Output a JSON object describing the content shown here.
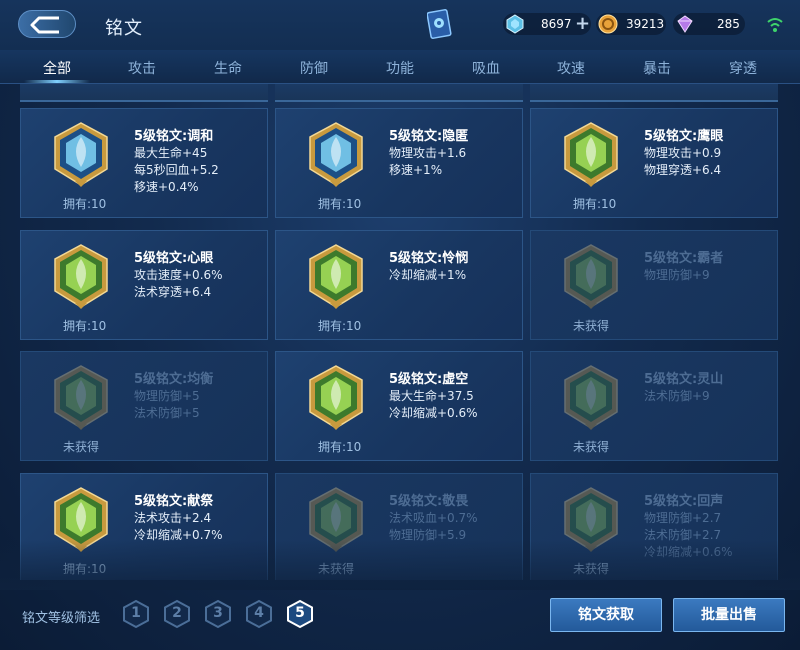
{
  "header": {
    "title": "铭文",
    "currencies": [
      {
        "icon": "diamond-icon",
        "value": "8697"
      },
      {
        "icon": "gold-coin-icon",
        "value": "39213"
      },
      {
        "icon": "purple-crystal-icon",
        "value": "285"
      }
    ]
  },
  "tabs": [
    {
      "label": "全部",
      "active": true
    },
    {
      "label": "攻击"
    },
    {
      "label": "生命"
    },
    {
      "label": "防御"
    },
    {
      "label": "功能"
    },
    {
      "label": "吸血"
    },
    {
      "label": "攻速"
    },
    {
      "label": "暴击"
    },
    {
      "label": "穿透"
    }
  ],
  "cards": [
    {
      "title": "5级铭文:调和",
      "stats": [
        "最大生命+45",
        "每5秒回血+5.2",
        "移速+0.4%"
      ],
      "status": "拥有:10",
      "owned": true,
      "color": "blue"
    },
    {
      "title": "5级铭文:隐匿",
      "stats": [
        "物理攻击+1.6",
        "移速+1%"
      ],
      "status": "拥有:10",
      "owned": true,
      "color": "blue"
    },
    {
      "title": "5级铭文:鹰眼",
      "stats": [
        "物理攻击+0.9",
        "物理穿透+6.4"
      ],
      "status": "拥有:10",
      "owned": true,
      "color": "green"
    },
    {
      "title": "5级铭文:心眼",
      "stats": [
        "攻击速度+0.6%",
        "法术穿透+6.4"
      ],
      "status": "拥有:10",
      "owned": true,
      "color": "green"
    },
    {
      "title": "5级铭文:怜悯",
      "stats": [
        "冷却缩减+1%"
      ],
      "status": "拥有:10",
      "owned": true,
      "color": "green"
    },
    {
      "title": "5级铭文:霸者",
      "stats": [
        "物理防御+9"
      ],
      "status": "未获得",
      "owned": false,
      "color": "green"
    },
    {
      "title": "5级铭文:均衡",
      "stats": [
        "物理防御+5",
        "法术防御+5"
      ],
      "status": "未获得",
      "owned": false,
      "color": "green"
    },
    {
      "title": "5级铭文:虚空",
      "stats": [
        "最大生命+37.5",
        "冷却缩减+0.6%"
      ],
      "status": "拥有:10",
      "owned": true,
      "color": "green"
    },
    {
      "title": "5级铭文:灵山",
      "stats": [
        "法术防御+9"
      ],
      "status": "未获得",
      "owned": false,
      "color": "green"
    },
    {
      "title": "5级铭文:献祭",
      "stats": [
        "法术攻击+2.4",
        "冷却缩减+0.7%"
      ],
      "status": "拥有:10",
      "owned": true,
      "color": "green"
    },
    {
      "title": "5级铭文:敬畏",
      "stats": [
        "法术吸血+0.7%",
        "物理防御+5.9"
      ],
      "status": "未获得",
      "owned": false,
      "color": "green"
    },
    {
      "title": "5级铭文:回声",
      "stats": [
        "物理防御+2.7",
        "法术防御+2.7",
        "冷却缩减+0.6%"
      ],
      "status": "未获得",
      "owned": false,
      "color": "green"
    }
  ],
  "footer": {
    "filter_label": "铭文等级筛选",
    "levels": [
      "1",
      "2",
      "3",
      "4",
      "5"
    ],
    "active_level": "5",
    "get_button": "铭文获取",
    "sell_button": "批量出售"
  },
  "colors": {
    "accent": "#7fd0ff",
    "button": "#2f6db0",
    "background": "#132e52"
  }
}
